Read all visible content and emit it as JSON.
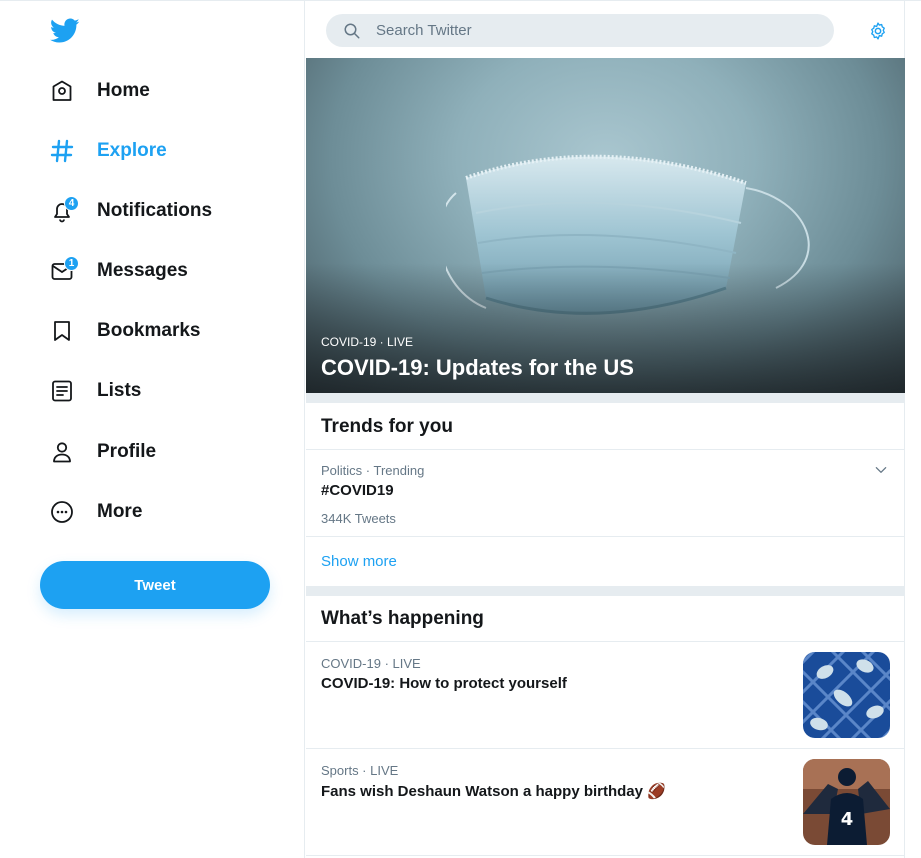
{
  "sidebar": {
    "items": [
      {
        "label": "Home",
        "icon": "home-icon"
      },
      {
        "label": "Explore",
        "icon": "hashtag-icon"
      },
      {
        "label": "Notifications",
        "icon": "bell-icon",
        "badge": "4"
      },
      {
        "label": "Messages",
        "icon": "envelope-icon",
        "badge": "1"
      },
      {
        "label": "Bookmarks",
        "icon": "bookmark-icon"
      },
      {
        "label": "Lists",
        "icon": "list-icon"
      },
      {
        "label": "Profile",
        "icon": "person-icon"
      },
      {
        "label": "More",
        "icon": "more-icon"
      }
    ],
    "active_item": "Explore",
    "tweet_button": "Tweet"
  },
  "search": {
    "placeholder": "Search Twitter"
  },
  "hero": {
    "kicker": "COVID-19 · LIVE",
    "title": "COVID-19: Updates for the US"
  },
  "trends": {
    "heading": "Trends for you",
    "items": [
      {
        "category": "Politics · Trending",
        "topic": "#COVID19",
        "count": "344K Tweets"
      }
    ],
    "show_more": "Show more"
  },
  "happening": {
    "heading": "What’s happening",
    "items": [
      {
        "meta": "COVID-19 · LIVE",
        "headline": "COVID-19: How to protect yourself"
      },
      {
        "meta": "Sports · LIVE",
        "headline": "Fans wish Deshaun Watson a happy birthday 🏈"
      }
    ]
  },
  "colors": {
    "accent": "#1da1f2",
    "text": "#14171a",
    "muted": "#657786",
    "divider": "#e6ecf0"
  }
}
